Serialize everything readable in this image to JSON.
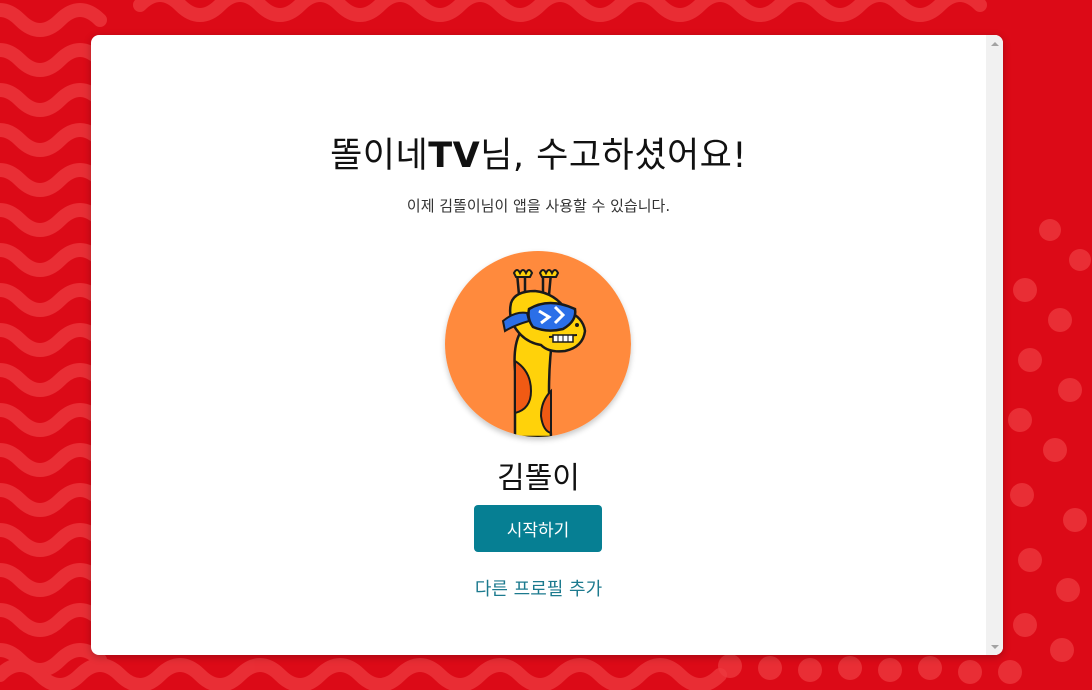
{
  "page": {
    "title_prefix": "똘이네",
    "title_brand": "TV",
    "title_suffix": "님, 수고하셨어요!",
    "subtitle": "이제 김똘이님이 앱을 사용할 수 있습니다."
  },
  "profile": {
    "name": "김똘이",
    "avatar_icon": "giraffe-sunglasses-avatar"
  },
  "actions": {
    "start_label": "시작하기",
    "add_profile_label": "다른 프로필 추가"
  },
  "colors": {
    "background": "#dc0a17",
    "card": "#ffffff",
    "button": "#067f93",
    "link": "#1c7a8e",
    "avatar_bg": "#ff8a3d",
    "giraffe": "#ffd20a"
  }
}
